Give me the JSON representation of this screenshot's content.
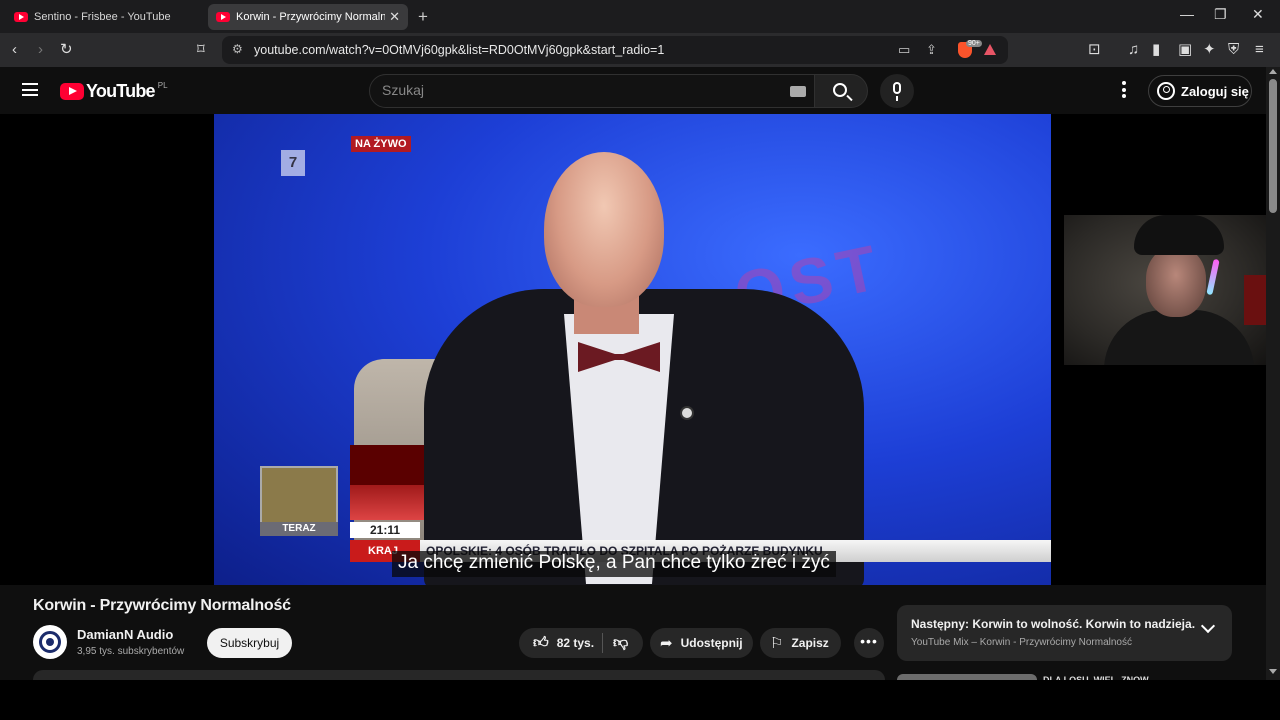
{
  "browser": {
    "tabs": [
      {
        "title": "Sentino - Frisbee - YouTube",
        "active": false
      },
      {
        "title": "Korwin - Przywrócimy Normalność",
        "active": true
      }
    ],
    "address": "youtube.com/watch?v=0OtMVj60gpk&list=RD0OtMVj60gpk&start_radio=1",
    "brave_badge": "90+",
    "icons": [
      "back-icon",
      "forward-icon",
      "reload-icon",
      "bookmark-icon",
      "site-info-icon",
      "cast-icon",
      "share-icon",
      "brave-shields-icon",
      "brave-rewards-icon",
      "screenshot-icon",
      "music-icon",
      "sidebar-icon",
      "wallet-icon",
      "leo-ai-icon",
      "vpn-icon",
      "menu-icon"
    ]
  },
  "youtube": {
    "logo": "YouTube",
    "region": "PL",
    "search_placeholder": "Szukaj",
    "login_label": "Zaloguj się"
  },
  "video": {
    "overlay_live": "NA ŻYWO",
    "channel_bug": "7",
    "teraz": "TERAZ",
    "clock": "21:11",
    "kraj": "KRAJ",
    "ticker": "OPOLSKIE: 4 OSÓB TRAFIŁO DO SZPITALA PO POŻARZE BUDYNKU",
    "caption": "Ja chcę zmienić Polskę, a Pan chce tylko żreć i żyć",
    "studio_text": "OST"
  },
  "below": {
    "title": "Korwin - Przywrócimy Normalność",
    "channel_name": "DamianN Audio",
    "channel_subs": "3,95 tys. subskrybentów",
    "subscribe_label": "Subskrybuj",
    "likes": "82 tys.",
    "share_label": "Udostępnij",
    "save_label": "Zapisz",
    "next_title": "Następny: Korwin to wolność. Korwin to nadzieja.",
    "next_sub": "YouTube Mix – Korwin - Przywrócimy Normalność",
    "peek_title": "DLA LOSU, WIEL, ZNOW..."
  }
}
